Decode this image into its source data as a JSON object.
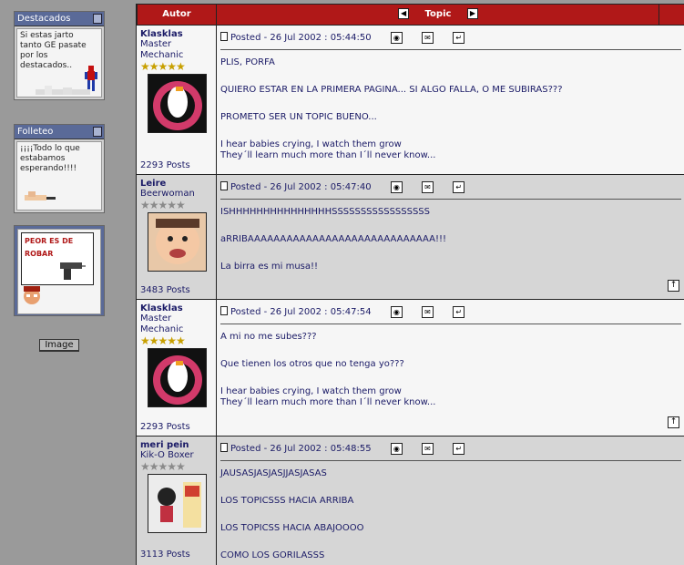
{
  "sidebar": {
    "destacados": {
      "title": "Destacados",
      "text": "Si estas jarto\ntanto GE pasate\npor los\ndestacados.."
    },
    "folleteo": {
      "title": "Folleteo",
      "text": "¡¡¡¡Todo lo que\nestabamos\nesperando!!!!"
    },
    "robar": {
      "text": "PEOR ES DE\nROBAR"
    },
    "image_button": "Image"
  },
  "table": {
    "autor_header": "Autor",
    "topic_header": "Topic"
  },
  "posts": [
    {
      "username": "Klasklas",
      "title": "Master\nMechanic",
      "post_count": "2293 Posts",
      "stars": "★★★★★",
      "posted": "Posted - 26 Jul 2002 :  05:44:50",
      "lines": [
        "PLIS, PORFA",
        "QUIERO ESTAR EN LA PRIMERA PAGINA... SI ALGO FALLA, O ME SUBIRAS???",
        "PROMETO SER UN TOPIC BUENO...",
        "I hear babies crying, I watch them grow\nThey´ll learn much more than I´ll never know..."
      ]
    },
    {
      "username": "Leire",
      "title": "Beerwoman",
      "post_count": "3483 Posts",
      "stars": "★★★★★",
      "posted": "Posted - 26 Jul 2002 :  05:47:40",
      "lines": [
        "ISHHHHHHHHHHHHHHHSSSSSSSSSSSSSSSSS",
        "aRRIBAAAAAAAAAAAAAAAAAAAAAAAAAAAAA!!!",
        "La birra es mi musa!!"
      ]
    },
    {
      "username": "Klasklas",
      "title": "Master\nMechanic",
      "post_count": "2293 Posts",
      "stars": "★★★★★",
      "posted": "Posted - 26 Jul 2002 :  05:47:54",
      "lines": [
        "A mi no me subes???",
        "Que tienen los otros que no tenga yo???",
        "I hear babies crying, I watch them grow\nThey´ll learn much more than I´ll never know..."
      ]
    },
    {
      "username": "meri pein",
      "title": "Kik-O Boxer",
      "post_count": "3113 Posts",
      "stars": "★★★★★",
      "posted": "Posted - 26 Jul 2002 :  05:48:55",
      "lines": [
        "JAUSASJASJASJJASJASAS",
        "LOS TOPICSSS HACIA ARRIBA",
        "LOS TOPICSS HACIA ABAJOOOO",
        "COMO LOS GORILASSS"
      ]
    }
  ],
  "colors": {
    "header_red": "#b01818",
    "text_navy": "#1a1a66",
    "widget_blue": "#5a6a98"
  },
  "icons": [
    "document-icon",
    "profile-icon",
    "email-icon",
    "reply-icon",
    "scroll-top-icon",
    "arrow-left-icon",
    "arrow-right-icon"
  ]
}
